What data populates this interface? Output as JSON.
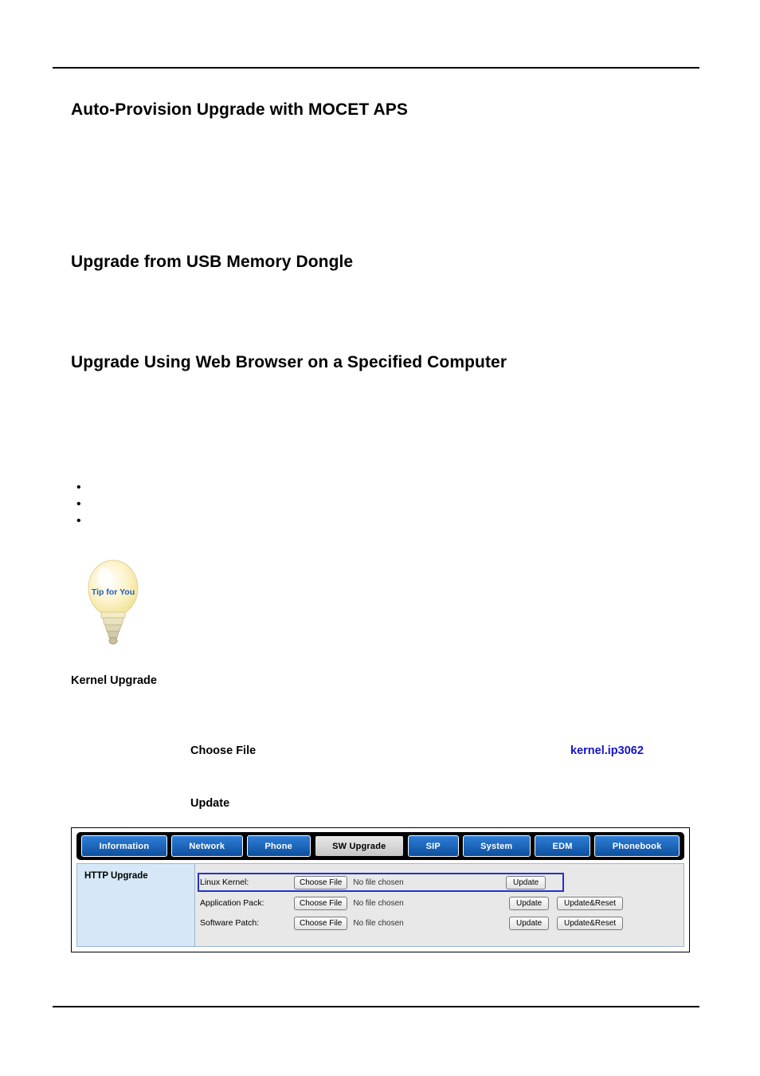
{
  "document": {
    "headings": {
      "aps": "Auto-Provision Upgrade with MOCET APS",
      "usb": "Upgrade from USB Memory Dongle",
      "web": "Upgrade Using Web Browser on a Specified Computer"
    },
    "bullets": [
      "",
      "",
      ""
    ],
    "tip_graphic_label": "Tip for You",
    "labels": {
      "kernel_upgrade": "Kernel Upgrade",
      "choose_file": "Choose File",
      "kernel_file": "kernel.ip3062",
      "update": "Update"
    }
  },
  "device_ui": {
    "nav": [
      {
        "label": "Information",
        "active": false
      },
      {
        "label": "Network",
        "active": false
      },
      {
        "label": "Phone",
        "active": false
      },
      {
        "label": "SW Upgrade",
        "active": true
      },
      {
        "label": "SIP",
        "active": false
      },
      {
        "label": "System",
        "active": false
      },
      {
        "label": "EDM",
        "active": false
      },
      {
        "label": "Phonebook",
        "active": false
      }
    ],
    "panel_title": "HTTP Upgrade",
    "rows": [
      {
        "label": "Linux Kernel:",
        "choose": "Choose File",
        "file_status": "No file chosen",
        "update": "Update",
        "update_reset": ""
      },
      {
        "label": "Application Pack:",
        "choose": "Choose File",
        "file_status": "No file chosen",
        "update": "Update",
        "update_reset": "Update&Reset"
      },
      {
        "label": "Software Patch:",
        "choose": "Choose File",
        "file_status": "No file chosen",
        "update": "Update",
        "update_reset": "Update&Reset"
      }
    ]
  }
}
